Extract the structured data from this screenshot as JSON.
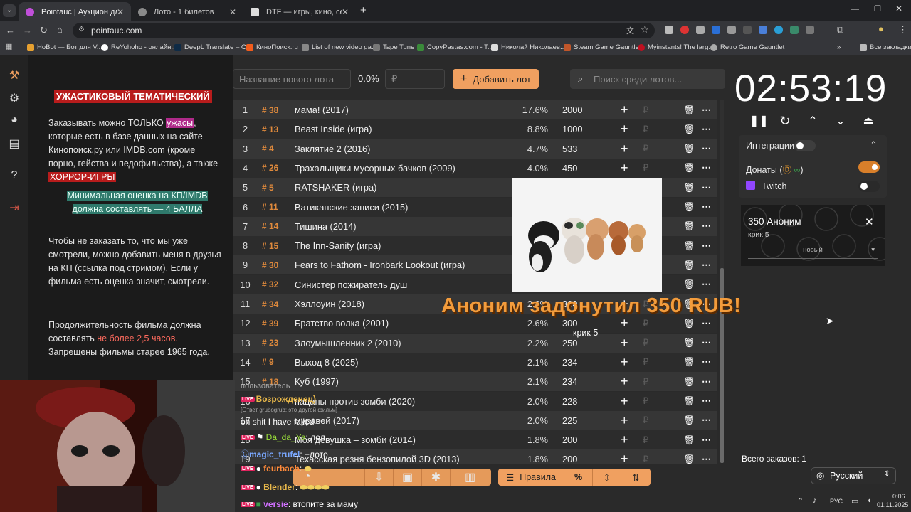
{
  "browser": {
    "tabs": [
      {
        "title": "Pointauc | Аукцион для стримеров",
        "active": true
      },
      {
        "title": "Лото - 1 билетов",
        "active": false
      },
      {
        "title": "DTF — игры, кино, сериалы, р",
        "active": false
      }
    ],
    "url": "pointauc.com",
    "bookmarks": [
      "HoBot — Бот для V...",
      "ReYohoho - онлайн...",
      "DeepL Translate – С...",
      "КиноПоиск.ru",
      "List of new video ga...",
      "Tape Tune",
      "CopyPastas.com - T...",
      "Николай Николаев...",
      "Steam Game Gauntlet",
      "Myinstants! The larg...",
      "Retro Game Gauntlet"
    ],
    "all_bookmarks": "Все закладки"
  },
  "rules": {
    "title": "УЖАСТИКОВЫЙ ТЕМАТИЧЕСКИЙ",
    "p1_a": "Заказывать можно ТОЛЬКО ",
    "p1_hl": "ужасы",
    "p1_b": ", которые есть в базе данных на сайте Кинопоиск.ру или IMDB.com (кроме порно, гейства и педофильства), а также ",
    "p1_hl2": "ХОРРОР-ИГРЫ",
    "min_rating": "Минимальная оценка на КП/IMDB должна составлять — 4 БАЛЛА",
    "p3": "Чтобы не заказать то, что мы уже смотрели, можно добавить меня в друзья на КП (ссылка под стримом). Если у фильма есть оценка-значит, смотрели.",
    "p4_a": "Продолжительность фильма должна составлять ",
    "p4_red": "не более 2,5 часов.",
    "p4_b": " Запрещены фильмы старее 1965 года."
  },
  "controls": {
    "new_lot_placeholder": "Название нового лота",
    "percent": "0.0%",
    "amount_placeholder": "₽",
    "add_button": "Добавить лот",
    "search_placeholder": "Поиск среди лотов..."
  },
  "lots": [
    {
      "n": "1",
      "id": "# 38",
      "name": "мама! (2017)",
      "pct": "17.6%",
      "amt": "2000"
    },
    {
      "n": "2",
      "id": "# 13",
      "name": "Beast Inside (игра)",
      "pct": "8.8%",
      "amt": "1000"
    },
    {
      "n": "3",
      "id": "# 4",
      "name": "Заклятие 2 (2016)",
      "pct": "4.7%",
      "amt": "533"
    },
    {
      "n": "4",
      "id": "# 26",
      "name": "Трахальщики мусорных бачков (2009)",
      "pct": "4.0%",
      "amt": "450"
    },
    {
      "n": "5",
      "id": "# 5",
      "name": "RATSHAKER (игра)",
      "pct": "",
      "amt": ""
    },
    {
      "n": "6",
      "id": "# 11",
      "name": "Ватиканские записи (2015)",
      "pct": "",
      "amt": ""
    },
    {
      "n": "7",
      "id": "# 14",
      "name": "Тишина (2014)",
      "pct": "",
      "amt": ""
    },
    {
      "n": "8",
      "id": "# 15",
      "name": "The Inn-Sanity (игра)",
      "pct": "",
      "amt": ""
    },
    {
      "n": "9",
      "id": "# 30",
      "name": "Fears to Fathom - Ironbark Lookout (игра)",
      "pct": "",
      "amt": ""
    },
    {
      "n": "10",
      "id": "# 32",
      "name": "Синистер пожиратель душ",
      "pct": "",
      "amt": ""
    },
    {
      "n": "11",
      "id": "# 34",
      "name": "Хэллоуин (2018)",
      "pct": "2.6%",
      "amt": "300"
    },
    {
      "n": "12",
      "id": "# 39",
      "name": "Братство волка (2001)",
      "pct": "2.6%",
      "amt": "300"
    },
    {
      "n": "13",
      "id": "# 23",
      "name": "Злоумышленник 2 (2010)",
      "pct": "2.2%",
      "amt": "250"
    },
    {
      "n": "14",
      "id": "# 9",
      "name": "Выход 8 (2025)",
      "pct": "2.1%",
      "amt": "234"
    },
    {
      "n": "15",
      "id": "# 18",
      "name": "Куб (1997)",
      "pct": "2.1%",
      "amt": "234"
    },
    {
      "n": "16",
      "id": "",
      "name": "пацаны против зомби (2020)",
      "pct": "2.0%",
      "amt": "228"
    },
    {
      "n": "17",
      "id": "",
      "name": "муравей (2017)",
      "pct": "2.0%",
      "amt": "225"
    },
    {
      "n": "18",
      "id": "",
      "name": "Моя девушка – зомби (2014)",
      "pct": "1.8%",
      "amt": "200"
    },
    {
      "n": "19",
      "id": "",
      "name": "Техасская резня бензопилой 3D (2013)",
      "pct": "1.8%",
      "amt": "200"
    }
  ],
  "timer": "02:53:19",
  "integrations": {
    "title": "Интеграции",
    "donations": "Донаты (",
    "donations_close": ")",
    "twitch": "Twitch"
  },
  "donation_card": {
    "title": "350 Аноним",
    "message": "крик 5",
    "status": "новый"
  },
  "alert": {
    "text": "Аноним задонутил 350 RUB!",
    "message": "крик 5"
  },
  "total_orders": "Всего заказов: 1",
  "bottom_bar": {
    "rules": "Правила",
    "percent": "%"
  },
  "language": "Русский",
  "chat": [
    {
      "user": "Возрожденец)",
      "text": "",
      "reply": "[Ответ grubogrub: это другой фильм]",
      "color": "#e8b84a"
    },
    {
      "user": "",
      "text": "oh shit I have failed",
      "color": "#fff"
    },
    {
      "user": "Da_da_Ya",
      "text": "лол",
      "color": "#9be03a"
    },
    {
      "user": "magic_trufel",
      "text": "+лото",
      "color": "#7aa8ff"
    },
    {
      "user": "feurbach",
      "text": "",
      "color": "#ff8a3a"
    },
    {
      "user": "Blender",
      "text": "",
      "color": "#e8b84a"
    },
    {
      "user": "versie",
      "text": "втопите за маму",
      "color": "#d070ff"
    }
  ],
  "chat_extra": {
    "partial_top": "пользователь",
    "reply_gap": "(Ответ"
  },
  "taskbar": {
    "lang": "РУС",
    "time": "0:06",
    "date": "01.11.2025"
  }
}
